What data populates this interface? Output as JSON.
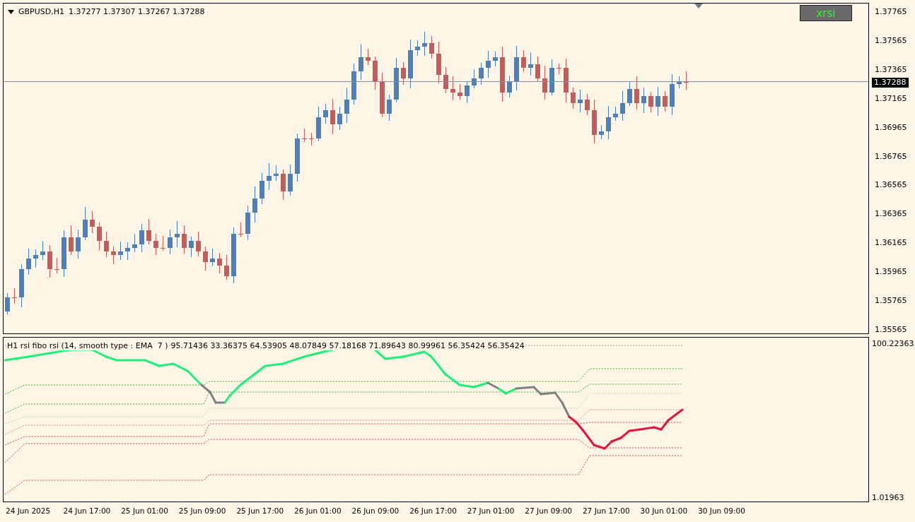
{
  "chart": {
    "symbol": "GBPUSD,H1",
    "ohlc": [
      "1.37277",
      "1.37307",
      "1.37267",
      "1.37288"
    ],
    "button": "xrsi",
    "current_price": "1.37288",
    "price_axis": [
      "1.37765",
      "1.37565",
      "1.37365",
      "1.37165",
      "1.36965",
      "1.36765",
      "1.36565",
      "1.36365",
      "1.36165",
      "1.35965",
      "1.35765",
      "1.35565"
    ]
  },
  "indicator": {
    "title": "H1 rsi fibo rsi (14, smooth type : EMA  7 )",
    "values": [
      "95.71436",
      "33.36375",
      "64.53905",
      "48.07849",
      "57.18168",
      "71.89643",
      "80.99961",
      "56.35424",
      "56.35424"
    ],
    "axis_max": "100.22363",
    "axis_min": "1.01963"
  },
  "time_axis": [
    "24 Jun 2025",
    "24 Jun 17:00",
    "25 Jun 01:00",
    "25 Jun 09:00",
    "25 Jun 17:00",
    "26 Jun 01:00",
    "26 Jun 09:00",
    "26 Jun 17:00",
    "27 Jun 01:00",
    "27 Jun 09:00",
    "27 Jun 17:00",
    "30 Jun 01:00",
    "30 Jun 09:00"
  ]
}
